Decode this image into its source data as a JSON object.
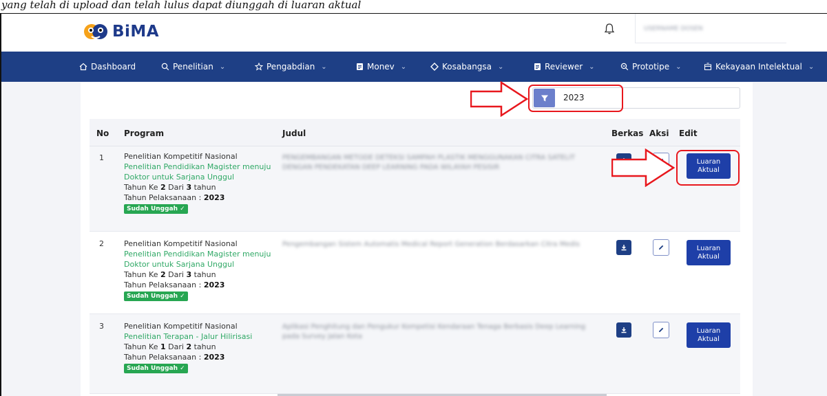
{
  "caption": "yang telah di upload dan telah lulus dapat diunggah di luaran aktual",
  "app": {
    "logo_text": "BiMA",
    "user_name": "USERNAME DOSEN"
  },
  "nav": [
    {
      "label": "Dashboard",
      "icon": "home-icon",
      "dropdown": false
    },
    {
      "label": "Penelitian",
      "icon": "search-icon",
      "dropdown": true
    },
    {
      "label": "Pengabdian",
      "icon": "star-icon",
      "dropdown": true
    },
    {
      "label": "Monev",
      "icon": "document-icon",
      "dropdown": true
    },
    {
      "label": "Kosabangsa",
      "icon": "diamond-icon",
      "dropdown": true
    },
    {
      "label": "Reviewer",
      "icon": "document-icon",
      "dropdown": true
    },
    {
      "label": "Prototipe",
      "icon": "zoom-icon",
      "dropdown": true
    },
    {
      "label": "Kekayaan Intelektual",
      "icon": "box-icon",
      "dropdown": true
    }
  ],
  "filter": {
    "year": "2023"
  },
  "table": {
    "headers": {
      "no": "No",
      "program": "Program",
      "judul": "Judul",
      "berkas": "Berkas",
      "aksi": "Aksi",
      "edit": "Edit"
    },
    "rows": [
      {
        "no": "1",
        "scheme": "Penelitian Kompetitif Nasional",
        "program": "Penelitian Pendidikan Magister menuju Doktor untuk Sarjana Unggul",
        "tahun_ke_label": "Tahun Ke",
        "tahun_ke": "2",
        "dari_label": "Dari",
        "dari": "3",
        "tahun_unit": "tahun",
        "pelaksanaan_label": "Tahun Pelaksanaan :",
        "pelaksanaan": "2023",
        "status": "Sudah Unggah ✓",
        "judul": "PENGEMBANGAN METODE DETEKSI SAMPAH PLASTIK MENGGUNAKAN CITRA SATELIT DENGAN PENDEKATAN DEEP LEARNING PADA WILAYAH PESISIR",
        "luaran_label": "Luaran Aktual"
      },
      {
        "no": "2",
        "scheme": "Penelitian Kompetitif Nasional",
        "program": "Penelitian Pendidikan Magister menuju Doktor untuk Sarjana Unggul",
        "tahun_ke_label": "Tahun Ke",
        "tahun_ke": "2",
        "dari_label": "Dari",
        "dari": "3",
        "tahun_unit": "tahun",
        "pelaksanaan_label": "Tahun Pelaksanaan :",
        "pelaksanaan": "2023",
        "status": "Sudah Unggah ✓",
        "judul": "Pengembangan Sistem Automatis Medical Report Generation Berdasarkan Citra Medis",
        "luaran_label": "Luaran Aktual"
      },
      {
        "no": "3",
        "scheme": "Penelitian Kompetitif Nasional",
        "program": "Penelitian Terapan - Jalur Hilirisasi",
        "tahun_ke_label": "Tahun Ke",
        "tahun_ke": "1",
        "dari_label": "Dari",
        "dari": "2",
        "tahun_unit": "tahun",
        "pelaksanaan_label": "Tahun Pelaksanaan :",
        "pelaksanaan": "2023",
        "status": "Sudah Unggah ✓",
        "judul": "Aplikasi Penghitung dan Pengukur Kompetisi Kendaraan Tenaga Berbasis Deep Learning pada Survey Jalan Kota",
        "luaran_label": "Luaran Aktual"
      }
    ]
  },
  "colors": {
    "navbar": "#1e3f85",
    "accent": "#2fa865",
    "highlight": "#e8171d",
    "button": "#1e3fa8"
  }
}
